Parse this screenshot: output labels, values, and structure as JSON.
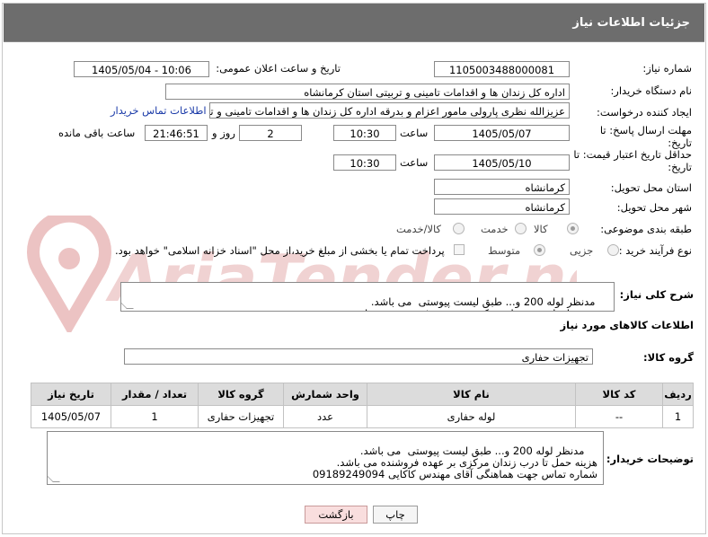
{
  "header": {
    "title": "جزئیات اطلاعات نیاز"
  },
  "fields": {
    "need_number_label": "شماره نیاز:",
    "need_number": "1105003488000081",
    "announce_label": "تاریخ و ساعت اعلان عمومی:",
    "announce_value": "1405/05/04 - 10:06",
    "buyer_org_label": "نام دستگاه خریدار:",
    "buyer_org": "اداره کل زندان ها و اقدامات تامینی و تربیتی استان کرمانشاه",
    "creator_label": "ایجاد کننده درخواست:",
    "creator": "عزیزالله نظری پارولی مامور اعزام و بدرقه اداره کل زندان ها و اقدامات تامینی و تربیتی",
    "buyer_contact_link": "اطلاعات تماس خریدار",
    "reply_deadline_label": "مهلت ارسال پاسخ: تا تاریخ:",
    "reply_date": "1405/05/07",
    "time_label": "ساعت",
    "reply_time": "10:30",
    "days_value": "2",
    "days_label": "روز و",
    "remaining_time": "21:46:51",
    "remaining_label": "ساعت باقی مانده",
    "price_deadline_label": "حداقل تاریخ اعتبار قیمت: تا تاریخ:",
    "price_date": "1405/05/10",
    "price_time": "10:30",
    "province_label": "استان محل تحویل:",
    "province": "کرمانشاه",
    "city_label": "شهر محل تحویل:",
    "city": "کرمانشاه",
    "category_label": "طبقه بندی موضوعی:",
    "category_options": [
      "کالا",
      "خدمت",
      "کالا/خدمت"
    ],
    "category_selected": "کالا",
    "process_label": "نوع فرآیند خرید :",
    "process_options": [
      "جزیی",
      "متوسط"
    ],
    "process_selected": "جزیی",
    "payment_note": "پرداخت تمام یا بخشی از مبلغ خرید،از محل \"اسناد خزانه اسلامی\" خواهد بود."
  },
  "description": {
    "label": "شرح کلی نیاز:",
    "text": "مدنظر لوله 200 و... طبق لیست پیوستی  می باشد.\nهزینه حمل تا درب زندان مرکزی بر عهده فروشنده می باشد."
  },
  "goods_section": {
    "title": "اطلاعات کالاهای مورد نیاز"
  },
  "goods_group": {
    "label": "گروه کالا:",
    "value": "تجهیزات حفاری"
  },
  "table": {
    "headers": [
      "ردیف",
      "کد کالا",
      "نام کالا",
      "واحد شمارش",
      "گروه کالا",
      "تعداد / مقدار",
      "تاریخ نیاز"
    ],
    "rows": [
      [
        "1",
        "--",
        "لوله حفاری",
        "عدد",
        "تجهیزات حفاری",
        "1",
        "1405/05/07"
      ]
    ]
  },
  "buyer_notes": {
    "label": "توضیحات خریدار:",
    "text": "مدنظر لوله 200 و... طبق لیست پیوستی  می باشد.\nهزینه حمل تا درب زندان مرکزی بر عهده فروشنده می باشد.\nشماره تماس جهت هماهنگی آقای مهندس کاکایی 09189249094"
  },
  "buttons": {
    "print": "چاپ",
    "back": "بازگشت"
  },
  "watermark": {
    "text": "AriaTender.neT"
  },
  "colors": {
    "header_bg": "#6d6d6d",
    "link": "#1a3aa8",
    "back_button_bg": "#f9dede",
    "watermark": "#e7b7b7"
  }
}
